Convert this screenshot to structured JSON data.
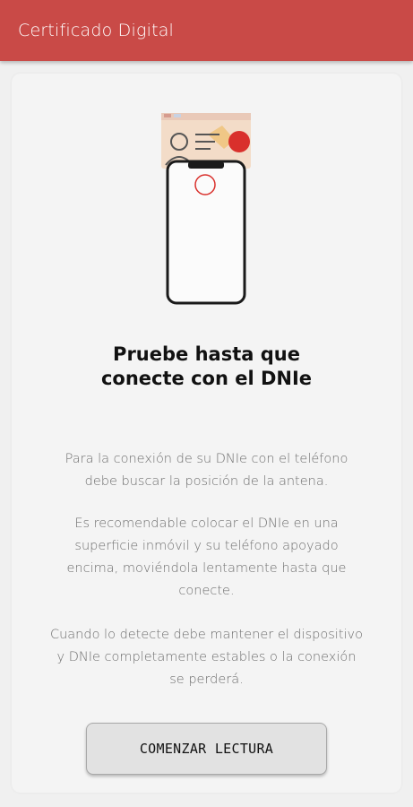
{
  "app_bar": {
    "title": "Certificado Digital"
  },
  "illustration": {
    "icon": "phone-on-dni-card-icon",
    "accent_color": "#d9302c"
  },
  "main": {
    "heading_lines": [
      "Pruebe hasta que",
      "conecte con el DNIe"
    ],
    "paragraph1_lines": [
      "Para la conexión de su DNIe con el teléfono",
      "debe buscar la posición de la antena."
    ],
    "paragraph2_lines": [
      "Es recomendable colocar el DNIe en una",
      "superficie inmóvil y su teléfono apoyado",
      "encima, moviéndola lentamente hasta que",
      "conecte."
    ],
    "paragraph3_lines": [
      "Cuando lo detecte debe mantener el dispositivo",
      "y DNIe completamente estables o la conexión",
      "se perderá."
    ]
  },
  "actions": {
    "start_label": "COMENZAR LECTURA"
  },
  "colors": {
    "app_bar": "#c94a47",
    "background": "#f0f0f0",
    "card": "#f4f4f4"
  }
}
